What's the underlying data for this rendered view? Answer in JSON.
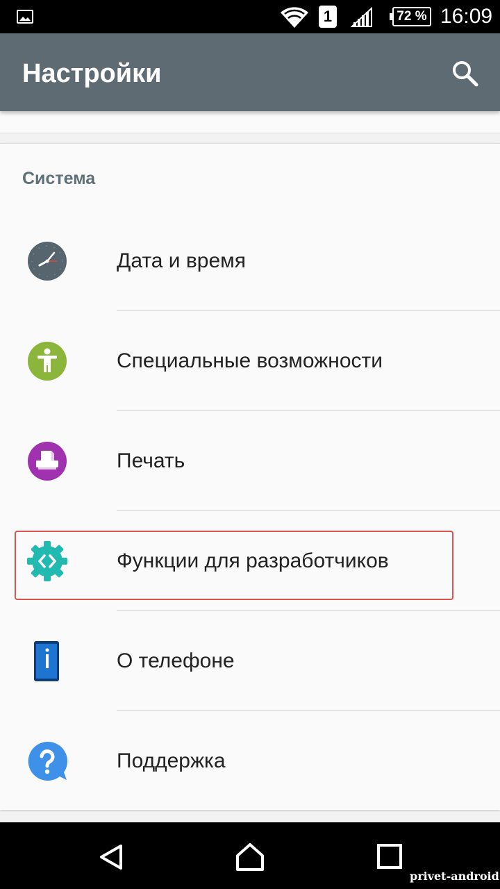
{
  "status_bar": {
    "sim_slot": "1",
    "battery": "72 %",
    "time": "16:09"
  },
  "action_bar": {
    "title": "Настройки",
    "search_icon": "search-icon"
  },
  "section": {
    "header": "Система",
    "items": [
      {
        "label": "Дата и время",
        "icon": "clock-icon",
        "color": "#56656e"
      },
      {
        "label": "Специальные возможности",
        "icon": "accessibility-icon",
        "color": "#8bb63b"
      },
      {
        "label": "Печать",
        "icon": "printer-icon",
        "color": "#a032b0"
      },
      {
        "label": "Функции для разработчиков",
        "icon": "developer-options-icon",
        "color": "#22b9b0",
        "highlighted": true
      },
      {
        "label": "О телефоне",
        "icon": "phone-info-icon",
        "color": "#1e74d0"
      },
      {
        "label": "Поддержка",
        "icon": "help-icon",
        "color": "#3f90e8"
      }
    ]
  },
  "nav_bar": {
    "back": "back-icon",
    "home": "home-icon",
    "recents": "recents-icon"
  },
  "watermark": "privet-android.ru"
}
